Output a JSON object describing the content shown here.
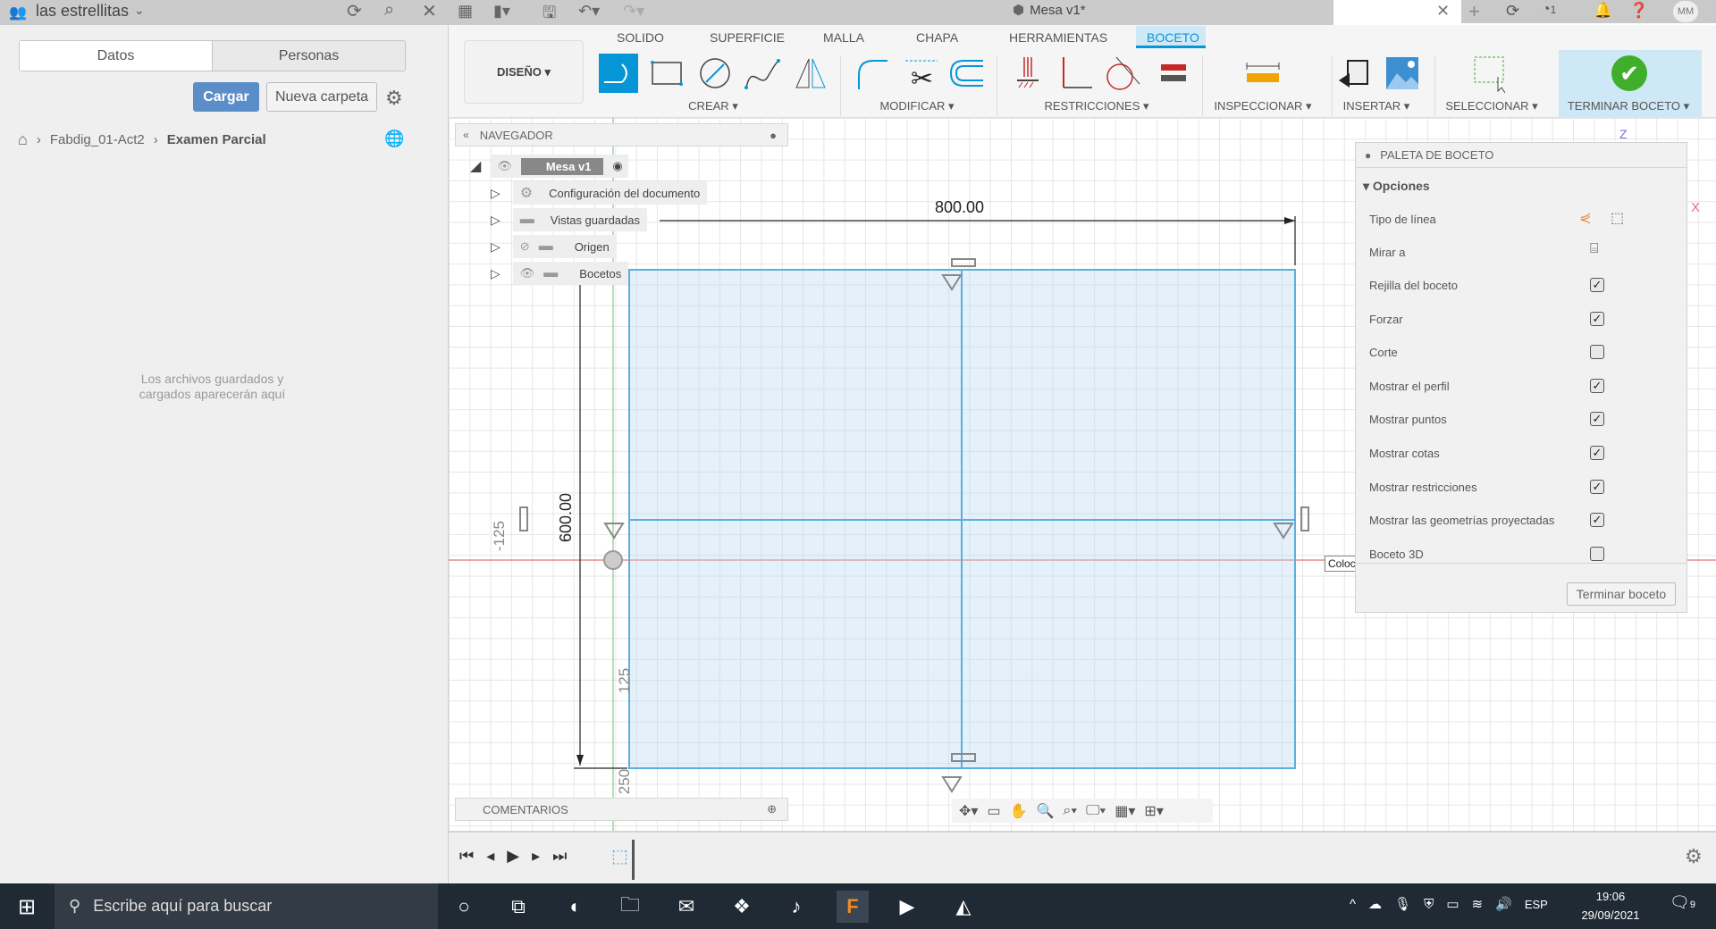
{
  "left_panel": {
    "team_name": "las estrellitas",
    "tabs": [
      "Datos",
      "Personas"
    ],
    "active_tab": "Datos",
    "upload_button": "Cargar",
    "new_folder_button": "Nueva carpeta",
    "breadcrumb": [
      "Fabdig_01-Act2",
      "Examen Parcial"
    ],
    "empty_message_line1": "Los archivos guardados y",
    "empty_message_line2": "cargados aparecerán aquí"
  },
  "document": {
    "title": "Mesa v1*"
  },
  "top_right": {
    "jobs_count": "1",
    "user_initials": "MM"
  },
  "toolbar": {
    "workspace": "DISEÑO ▾",
    "tabs": [
      "SOLIDO",
      "SUPERFICIE",
      "MALLA",
      "CHAPA",
      "HERRAMIENTAS",
      "BOCETO"
    ],
    "active_tab": "BOCETO",
    "groups": [
      "CREAR ▾",
      "MODIFICAR ▾",
      "RESTRICCIONES ▾",
      "INSPECCIONAR ▾",
      "INSERTAR ▾",
      "SELECCIONAR ▾",
      "TERMINAR BOCETO ▾"
    ],
    "accent": "#0696d7",
    "finish_color": "#3fae2a"
  },
  "navigator": {
    "title": "NAVEGADOR",
    "root": "Mesa v1",
    "items": [
      "Configuración del documento",
      "Vistas guardadas",
      "Origen",
      "Bocetos"
    ]
  },
  "comments": {
    "title": "COMENTARIOS"
  },
  "sketch": {
    "dim_width": "800.00",
    "dim_height": "600.00",
    "ruler_labels": [
      "-125",
      "125",
      "250"
    ],
    "axis_z": "Z",
    "axis_x": "X",
    "tooltip": "Colocar primer pu"
  },
  "palette": {
    "title": "PALETA DE BOCETO",
    "section": "Opciones",
    "line_type_label": "Tipo de línea",
    "look_at_label": "Mirar a",
    "options": [
      {
        "label": "Rejilla del boceto",
        "checked": true
      },
      {
        "label": "Forzar",
        "checked": true
      },
      {
        "label": "Corte",
        "checked": false
      },
      {
        "label": "Mostrar el perfil",
        "checked": true
      },
      {
        "label": "Mostrar puntos",
        "checked": true
      },
      {
        "label": "Mostrar cotas",
        "checked": true
      },
      {
        "label": "Mostrar restricciones",
        "checked": true
      },
      {
        "label": "Mostrar las geometrías proyectadas",
        "checked": true
      },
      {
        "label": "Boceto 3D",
        "checked": false
      }
    ],
    "finish_button": "Terminar boceto"
  },
  "taskbar": {
    "search_placeholder": "Escribe aquí para buscar",
    "language": "ESP",
    "time": "19:06",
    "date": "29/09/2021",
    "notifications": "9"
  }
}
